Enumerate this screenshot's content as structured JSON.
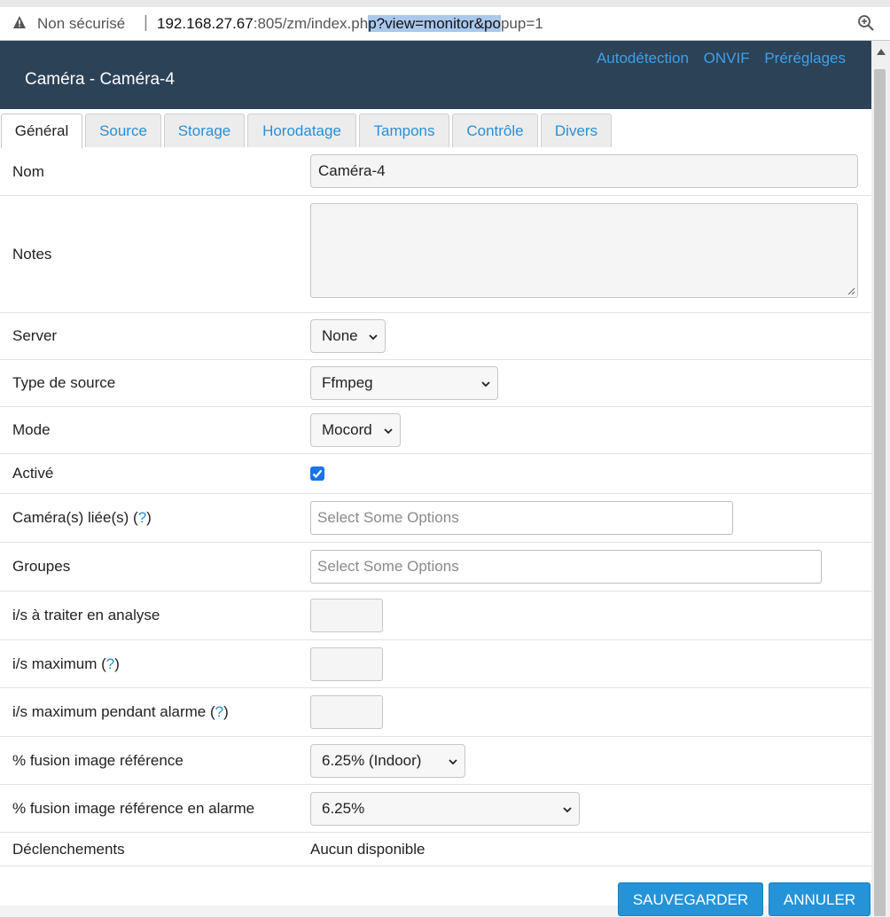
{
  "browser": {
    "security_label": "Non sécurisé",
    "url_host": "192.168.27.67",
    "url_path_before": ":805/zm/index.ph",
    "url_selected": "p?view=monitor&po",
    "url_after": "pup=1"
  },
  "header": {
    "title": "Caméra - Caméra-4",
    "links": [
      "Autodétection",
      "ONVIF",
      "Préréglages"
    ]
  },
  "tabs": [
    "Général",
    "Source",
    "Storage",
    "Horodatage",
    "Tampons",
    "Contrôle",
    "Divers"
  ],
  "active_tab": "Général",
  "form": {
    "name_label": "Nom",
    "name_value": "Caméra-4",
    "notes_label": "Notes",
    "notes_value": "",
    "server_label": "Server",
    "server_value": "None",
    "source_type_label": "Type de source",
    "source_type_value": "Ffmpeg",
    "mode_label": "Mode",
    "mode_value": "Mocord",
    "enabled_label": "Activé",
    "enabled_checked": true,
    "linked_label": "Caméra(s) liée(s) (",
    "linked_help": "?",
    "linked_label_end": ")",
    "linked_placeholder": "Select Some Options",
    "groups_label": "Groupes",
    "groups_placeholder": "Select Some Options",
    "analysis_fps_label": "i/s à traiter en analyse",
    "analysis_fps_value": "",
    "max_fps_label": "i/s maximum (",
    "max_fps_help": "?",
    "max_fps_label_end": ")",
    "max_fps_value": "",
    "alarm_max_fps_label": "i/s maximum pendant alarme (",
    "alarm_max_fps_help": "?",
    "alarm_max_fps_label_end": ")",
    "alarm_max_fps_value": "",
    "ref_blend_label": "% fusion image référence",
    "ref_blend_value": "6.25% (Indoor)",
    "alarm_ref_blend_label": "% fusion image référence en alarme",
    "alarm_ref_blend_value": "6.25%",
    "triggers_label": "Déclenchements",
    "triggers_value": "Aucun disponible"
  },
  "buttons": {
    "save": "SAUVEGARDER",
    "cancel": "ANNULER"
  },
  "colors": {
    "header_bg": "#2c4257",
    "link": "#3fa0e6",
    "button": "#2593d8",
    "checkbox": "#1a73e8"
  }
}
